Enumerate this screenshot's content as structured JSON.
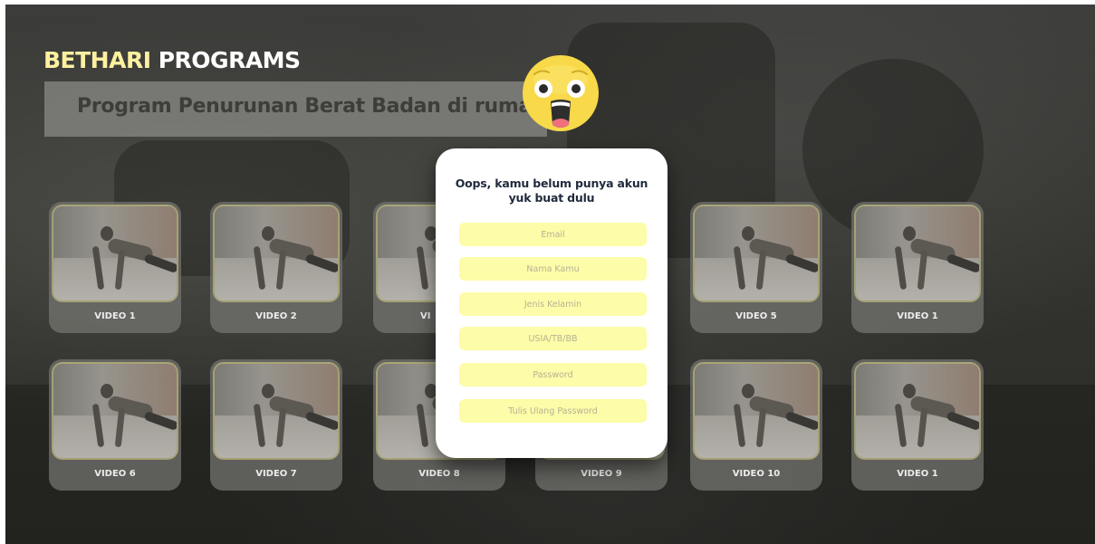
{
  "brand": {
    "part1": "BETHARI",
    "part2": "PROGRAMS"
  },
  "program": {
    "title": "Program Penurunan Berat Badan di rumah"
  },
  "videos_row1": [
    {
      "label": "VIDEO 1"
    },
    {
      "label": "VIDEO 2"
    },
    {
      "label": "VI"
    },
    {
      "label": ""
    },
    {
      "label": "VIDEO 5"
    },
    {
      "label": "VIDEO 1"
    }
  ],
  "videos_row2": [
    {
      "label": "VIDEO 6"
    },
    {
      "label": "VIDEO 7"
    },
    {
      "label": "VIDEO 8"
    },
    {
      "label": "VIDEO 9"
    },
    {
      "label": "VIDEO 10"
    },
    {
      "label": "VIDEO 1"
    }
  ],
  "signup": {
    "title_line1": "Oops, kamu belum punya akun",
    "title_line2": "yuk buat dulu",
    "email_placeholder": "Email",
    "name_placeholder": "Nama Kamu",
    "gender_placeholder": "Jenis Kelamin",
    "age_placeholder": "USIA/TB/BB",
    "password_placeholder": "Password",
    "repassword_placeholder": "Tulis Ulang Password"
  },
  "icons": {
    "alert": "shocked-face-emoji-icon"
  },
  "colors": {
    "brand_yellow": "#fdf1a0",
    "field_yellow": "#fdfca8",
    "title_navy": "#1f2a3c",
    "emoji_yellow": "#f7d94a"
  }
}
